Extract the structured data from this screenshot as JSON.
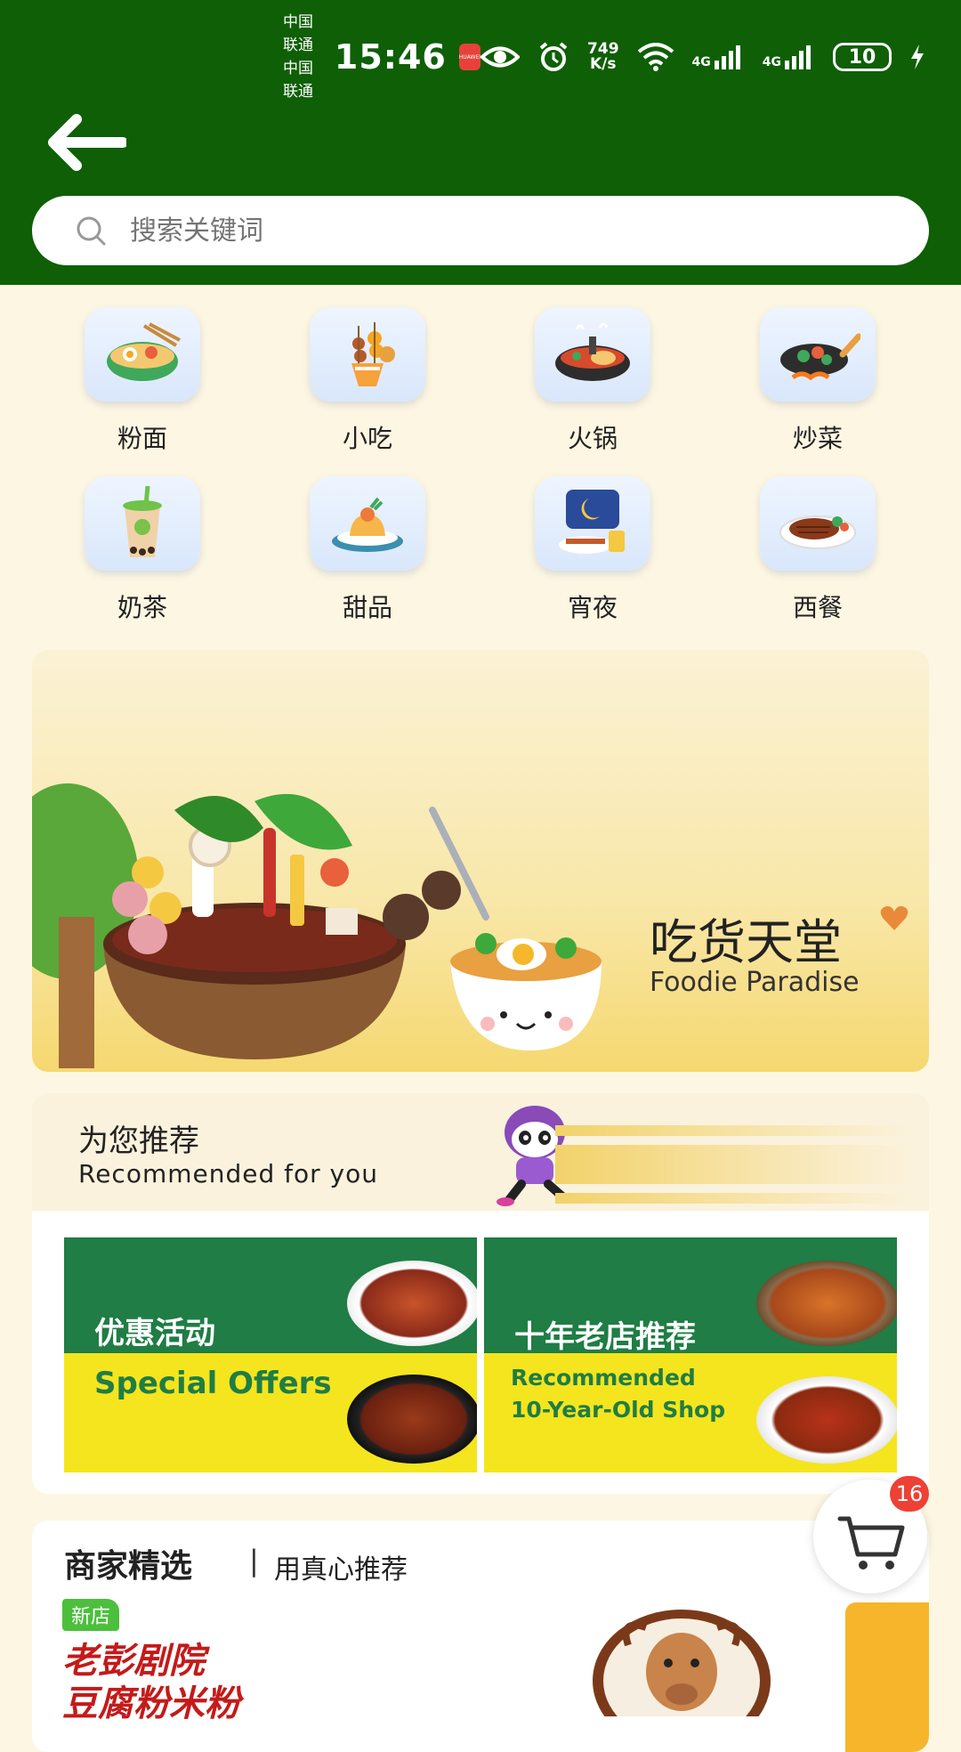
{
  "status_bar": {
    "carrier_1": "中国联通",
    "carrier_2": "中国联通",
    "time": "15:46",
    "net_speed_value": "749",
    "net_speed_unit": "K/s",
    "signal_1": "4G",
    "signal_2": "4G",
    "battery": "10",
    "notification_icon": "huawei-app-icon",
    "huawei_badge": "HUAWEI"
  },
  "header": {
    "back_icon": "arrow-left-icon",
    "background": "#0f5f07"
  },
  "search": {
    "placeholder": "搜索关键词",
    "icon": "search-icon"
  },
  "categories": [
    {
      "label": "粉面",
      "icon": "noodle-bowl-icon"
    },
    {
      "label": "小吃",
      "icon": "skewer-snack-icon"
    },
    {
      "label": "火锅",
      "icon": "hotpot-icon"
    },
    {
      "label": "炒菜",
      "icon": "wok-icon"
    },
    {
      "label": "奶茶",
      "icon": "milk-tea-icon"
    },
    {
      "label": "甜品",
      "icon": "dessert-icon"
    },
    {
      "label": "宵夜",
      "icon": "night-snack-icon"
    },
    {
      "label": "西餐",
      "icon": "steak-icon"
    }
  ],
  "banner": {
    "title": "吃货天堂",
    "subtitle": "Foodie Paradise"
  },
  "recommend": {
    "title": "为您推荐",
    "subtitle": "Recommended for you",
    "cards": [
      {
        "title": "优惠活动",
        "subtitle": "Special Offers"
      },
      {
        "title": "十年老店推荐",
        "subtitle_line1": "Recommended",
        "subtitle_line2": "10-Year-Old Shop"
      }
    ]
  },
  "merchant": {
    "title": "商家精选",
    "separator": "|",
    "subtitle": "用真心推荐",
    "badge": "新店",
    "shop_name_line1": "老彭剧院",
    "shop_name_line2": "豆腐粉米粉"
  },
  "cart": {
    "count": "16",
    "icon": "shopping-cart-icon"
  },
  "colors": {
    "brand_green": "#0f5f07",
    "page_bg": "#fdf6e2",
    "promo_green": "#1f7d45",
    "promo_yellow": "#f4e51e",
    "badge_red": "#ee4035"
  }
}
